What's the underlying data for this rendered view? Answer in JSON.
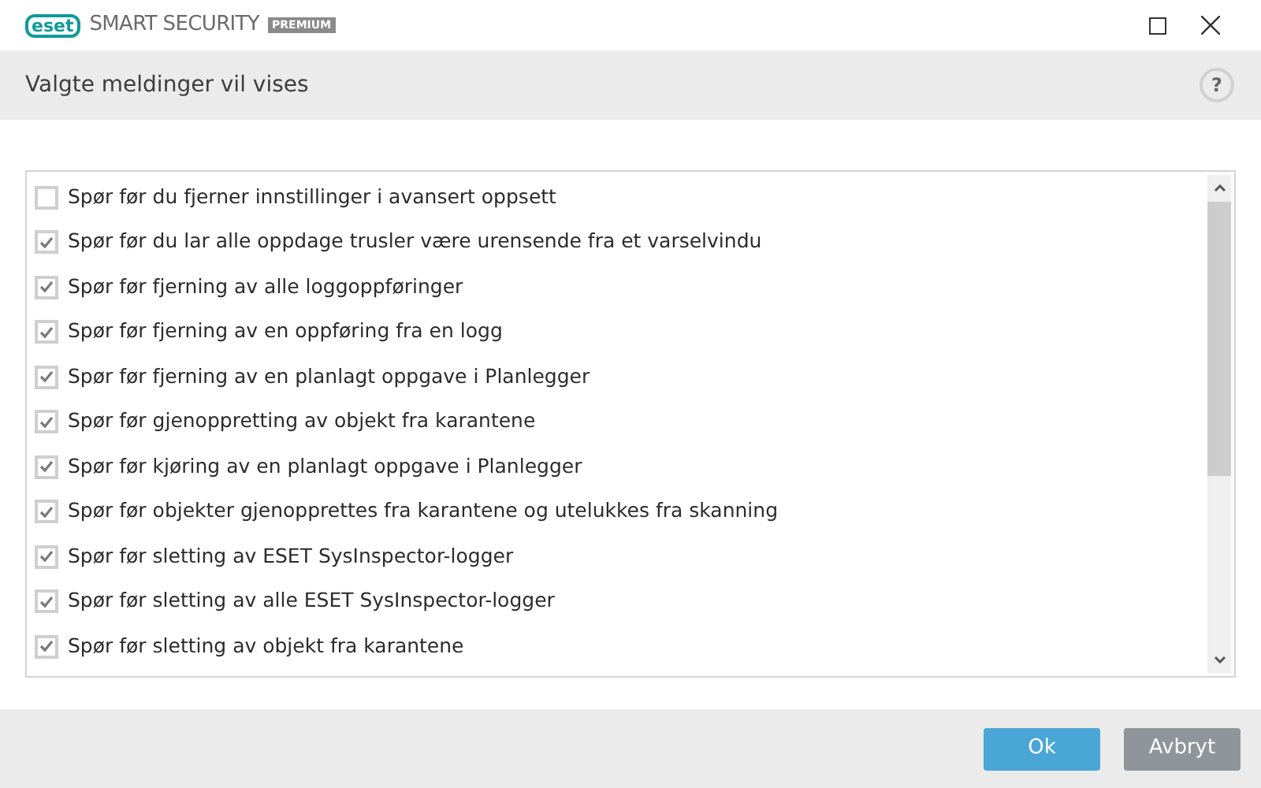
{
  "window": {
    "logo": "eset",
    "product": "SMART SECURITY",
    "edition": "PREMIUM"
  },
  "header": {
    "title": "Valgte meldinger vil vises",
    "help": "?"
  },
  "options": [
    {
      "label": "Spør før du fjerner innstillinger i avansert oppsett",
      "checked": false
    },
    {
      "label": "Spør før du lar alle oppdage trusler være urensende fra et varselvindu",
      "checked": true
    },
    {
      "label": "Spør før fjerning av alle loggoppføringer",
      "checked": true
    },
    {
      "label": "Spør før fjerning av en oppføring fra en logg",
      "checked": true
    },
    {
      "label": "Spør før fjerning av en planlagt oppgave i Planlegger",
      "checked": true
    },
    {
      "label": "Spør før gjenoppretting av objekt fra karantene",
      "checked": true
    },
    {
      "label": "Spør før kjøring av en planlagt oppgave i Planlegger",
      "checked": true
    },
    {
      "label": "Spør før objekter gjenopprettes fra karantene og utelukkes fra skanning",
      "checked": true
    },
    {
      "label": "Spør før sletting av ESET SysInspector-logger",
      "checked": true
    },
    {
      "label": "Spør før sletting av alle ESET SysInspector-logger",
      "checked": true
    },
    {
      "label": "Spør før sletting av objekt fra karantene",
      "checked": true
    }
  ],
  "buttons": [
    {
      "label": "Ok",
      "kind": "primary"
    },
    {
      "label": "Avbryt",
      "kind": "secondary"
    }
  ]
}
